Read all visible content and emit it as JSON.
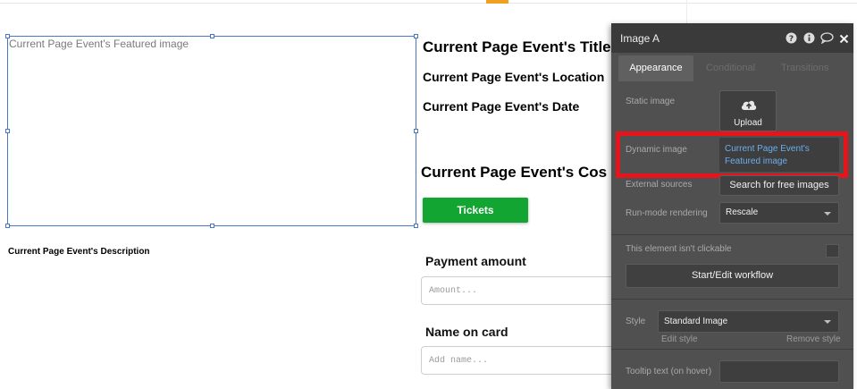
{
  "canvas": {
    "image_placeholder": "Current Page Event's Featured image",
    "event_title": "Current Page Event's Title",
    "event_location": "Current Page Event's Location",
    "event_date": "Current Page Event's Date",
    "event_cost": "Current Page Event's Cos",
    "tickets_button": "Tickets",
    "event_description": "Current Page Event's Description",
    "payment_label": "Payment amount",
    "payment_placeholder": "Amount...",
    "name_label": "Name on card",
    "name_placeholder": "Add name..."
  },
  "panel": {
    "title": "Image A",
    "header_icons": [
      "help-icon",
      "info-icon",
      "comment-icon",
      "close-icon"
    ],
    "tabs": [
      {
        "label": "Appearance",
        "active": true
      },
      {
        "label": "Conditional",
        "active": false
      },
      {
        "label": "Transitions",
        "active": false
      }
    ],
    "static_image_label": "Static image",
    "upload_label": "Upload",
    "dynamic_image_label": "Dynamic image",
    "dynamic_image_value": "Current Page Event's Featured image",
    "external_sources_label": "External sources",
    "search_button": "Search for free images",
    "run_mode_label": "Run-mode rendering",
    "run_mode_value": "Rescale",
    "not_clickable_label": "This element isn't clickable",
    "not_clickable_checked": false,
    "workflow_button": "Start/Edit workflow",
    "style_label": "Style",
    "style_value": "Standard Image",
    "edit_style": "Edit style",
    "remove_style": "Remove style",
    "tooltip_label": "Tooltip text (on hover)",
    "tooltip_value": ""
  },
  "colors": {
    "tickets_green": "#12a531",
    "selection_blue": "#4a76c8",
    "highlight_red": "#e8141c",
    "panel_bg": "#505050",
    "link_blue": "#6aaef0"
  }
}
